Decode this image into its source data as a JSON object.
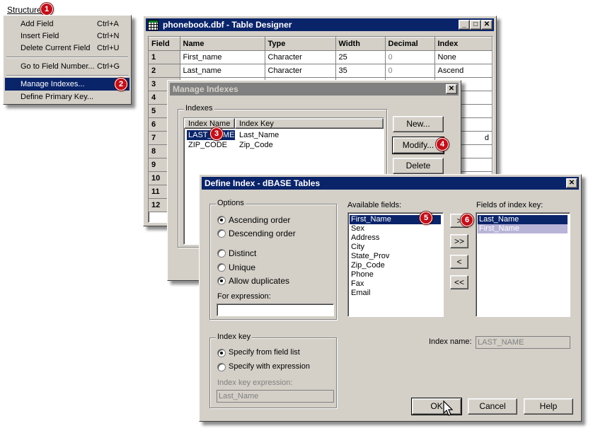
{
  "colors": {
    "title_active": "#0a246a",
    "title_inactive": "#808080",
    "face": "#d4d0c8",
    "badge": "#c0101a"
  },
  "menu": {
    "title": "Structure",
    "items": [
      {
        "label": "Add Field",
        "shortcut": "Ctrl+A"
      },
      {
        "label": "Insert Field",
        "shortcut": "Ctrl+N"
      },
      {
        "label": "Delete Current Field",
        "shortcut": "Ctrl+U"
      },
      {
        "label": "Go to Field Number...",
        "shortcut": "Ctrl+G"
      },
      {
        "label": "Manage Indexes...",
        "shortcut": ""
      },
      {
        "label": "Define Primary Key...",
        "shortcut": ""
      }
    ]
  },
  "table_designer": {
    "title": "phonebook.dbf - Table Designer",
    "icon": "table-grid-icon",
    "columns": [
      "Field",
      "Name",
      "Type",
      "Width",
      "Decimal",
      "Index"
    ],
    "rows": [
      {
        "field": "1",
        "name": "First_name",
        "type": "Character",
        "width": "25",
        "decimal": "0",
        "index": "None"
      },
      {
        "field": "2",
        "name": "Last_name",
        "type": "Character",
        "width": "35",
        "decimal": "0",
        "index": "Ascend"
      },
      {
        "field": "3"
      },
      {
        "field": "4"
      },
      {
        "field": "5"
      },
      {
        "field": "6"
      },
      {
        "field": "7",
        "index": "d"
      },
      {
        "field": "8"
      },
      {
        "field": "9"
      },
      {
        "field": "10"
      },
      {
        "field": "11"
      },
      {
        "field": "12"
      }
    ]
  },
  "manage_indexes": {
    "title": "Manage Indexes",
    "group_label": "Indexes",
    "col_name": "Index Name",
    "col_key": "Index Key",
    "rows": [
      {
        "name": "LAST_NAME",
        "key": "Last_Name"
      },
      {
        "name": "ZIP_CODE",
        "key": "Zip_Code"
      }
    ],
    "buttons": {
      "new": "New...",
      "modify": "Modify...",
      "delete": "Delete"
    }
  },
  "define_index": {
    "title": "Define Index - dBASE Tables",
    "options_label": "Options",
    "options": [
      "Ascending order",
      "Descending order",
      "Distinct",
      "Unique",
      "Allow duplicates"
    ],
    "for_expression_label": "For expression:",
    "for_expression_value": "",
    "index_key_label": "Index key",
    "index_key_options": [
      "Specify from field list",
      "Specify with expression"
    ],
    "index_key_expression_label": "Index key expression:",
    "index_key_expression_value": "Last_Name",
    "available_fields_label": "Available fields:",
    "available_fields": [
      "First_Name",
      "Sex",
      "Address",
      "City",
      "State_Prov",
      "Zip_Code",
      "Phone",
      "Fax",
      "Email"
    ],
    "fields_of_index_key_label": "Fields of index key:",
    "fields_of_index_key": [
      "Last_Name",
      "First_Name"
    ],
    "move_buttons": [
      ">",
      ">>",
      "<",
      "<<"
    ],
    "index_name_label": "Index name:",
    "index_name_value": "LAST_NAME",
    "buttons": {
      "ok": "OK",
      "cancel": "Cancel",
      "help": "Help"
    }
  },
  "callouts": [
    "1",
    "2",
    "3",
    "4",
    "5",
    "6"
  ]
}
